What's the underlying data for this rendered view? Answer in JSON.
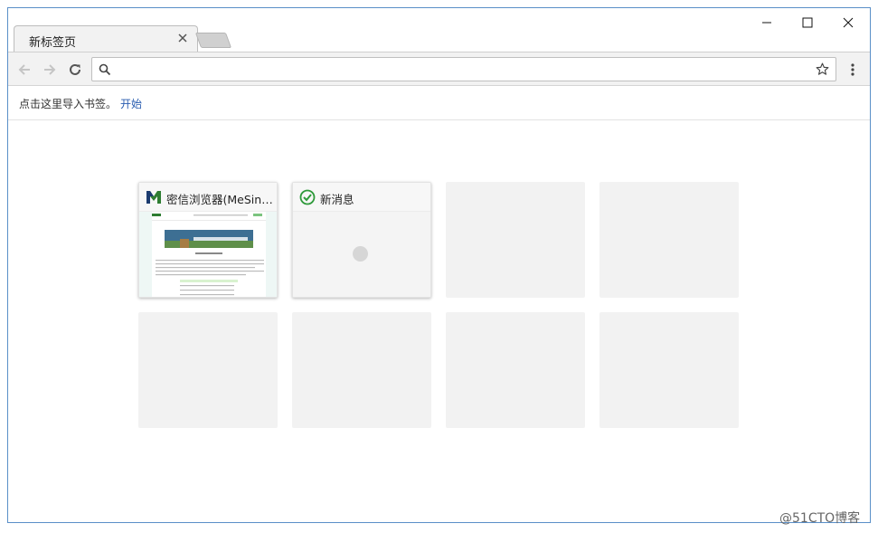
{
  "tab": {
    "title": "新标签页"
  },
  "window_controls": {
    "minimize": "minimize-icon",
    "maximize": "maximize-icon",
    "close": "close-icon"
  },
  "toolbar": {
    "back": "back-arrow-icon",
    "forward": "forward-arrow-icon",
    "reload": "reload-icon",
    "omnibox": {
      "value": "",
      "placeholder": ""
    },
    "menu": "more-vert-icon"
  },
  "bookmark_bar": {
    "text": "点击这里导入书签。",
    "link": "开始"
  },
  "tiles": [
    {
      "title": "密信浏览器(MeSinc...",
      "favicon": "mesince-logo-icon"
    },
    {
      "title": "新消息",
      "favicon": "green-check-icon"
    }
  ],
  "colors": {
    "accent": "#2a5db0",
    "window_border": "#5a8fc8",
    "toolbar": "#f2f2f2",
    "tile_empty": "#f2f2f2"
  },
  "watermark": "@51CTO博客"
}
